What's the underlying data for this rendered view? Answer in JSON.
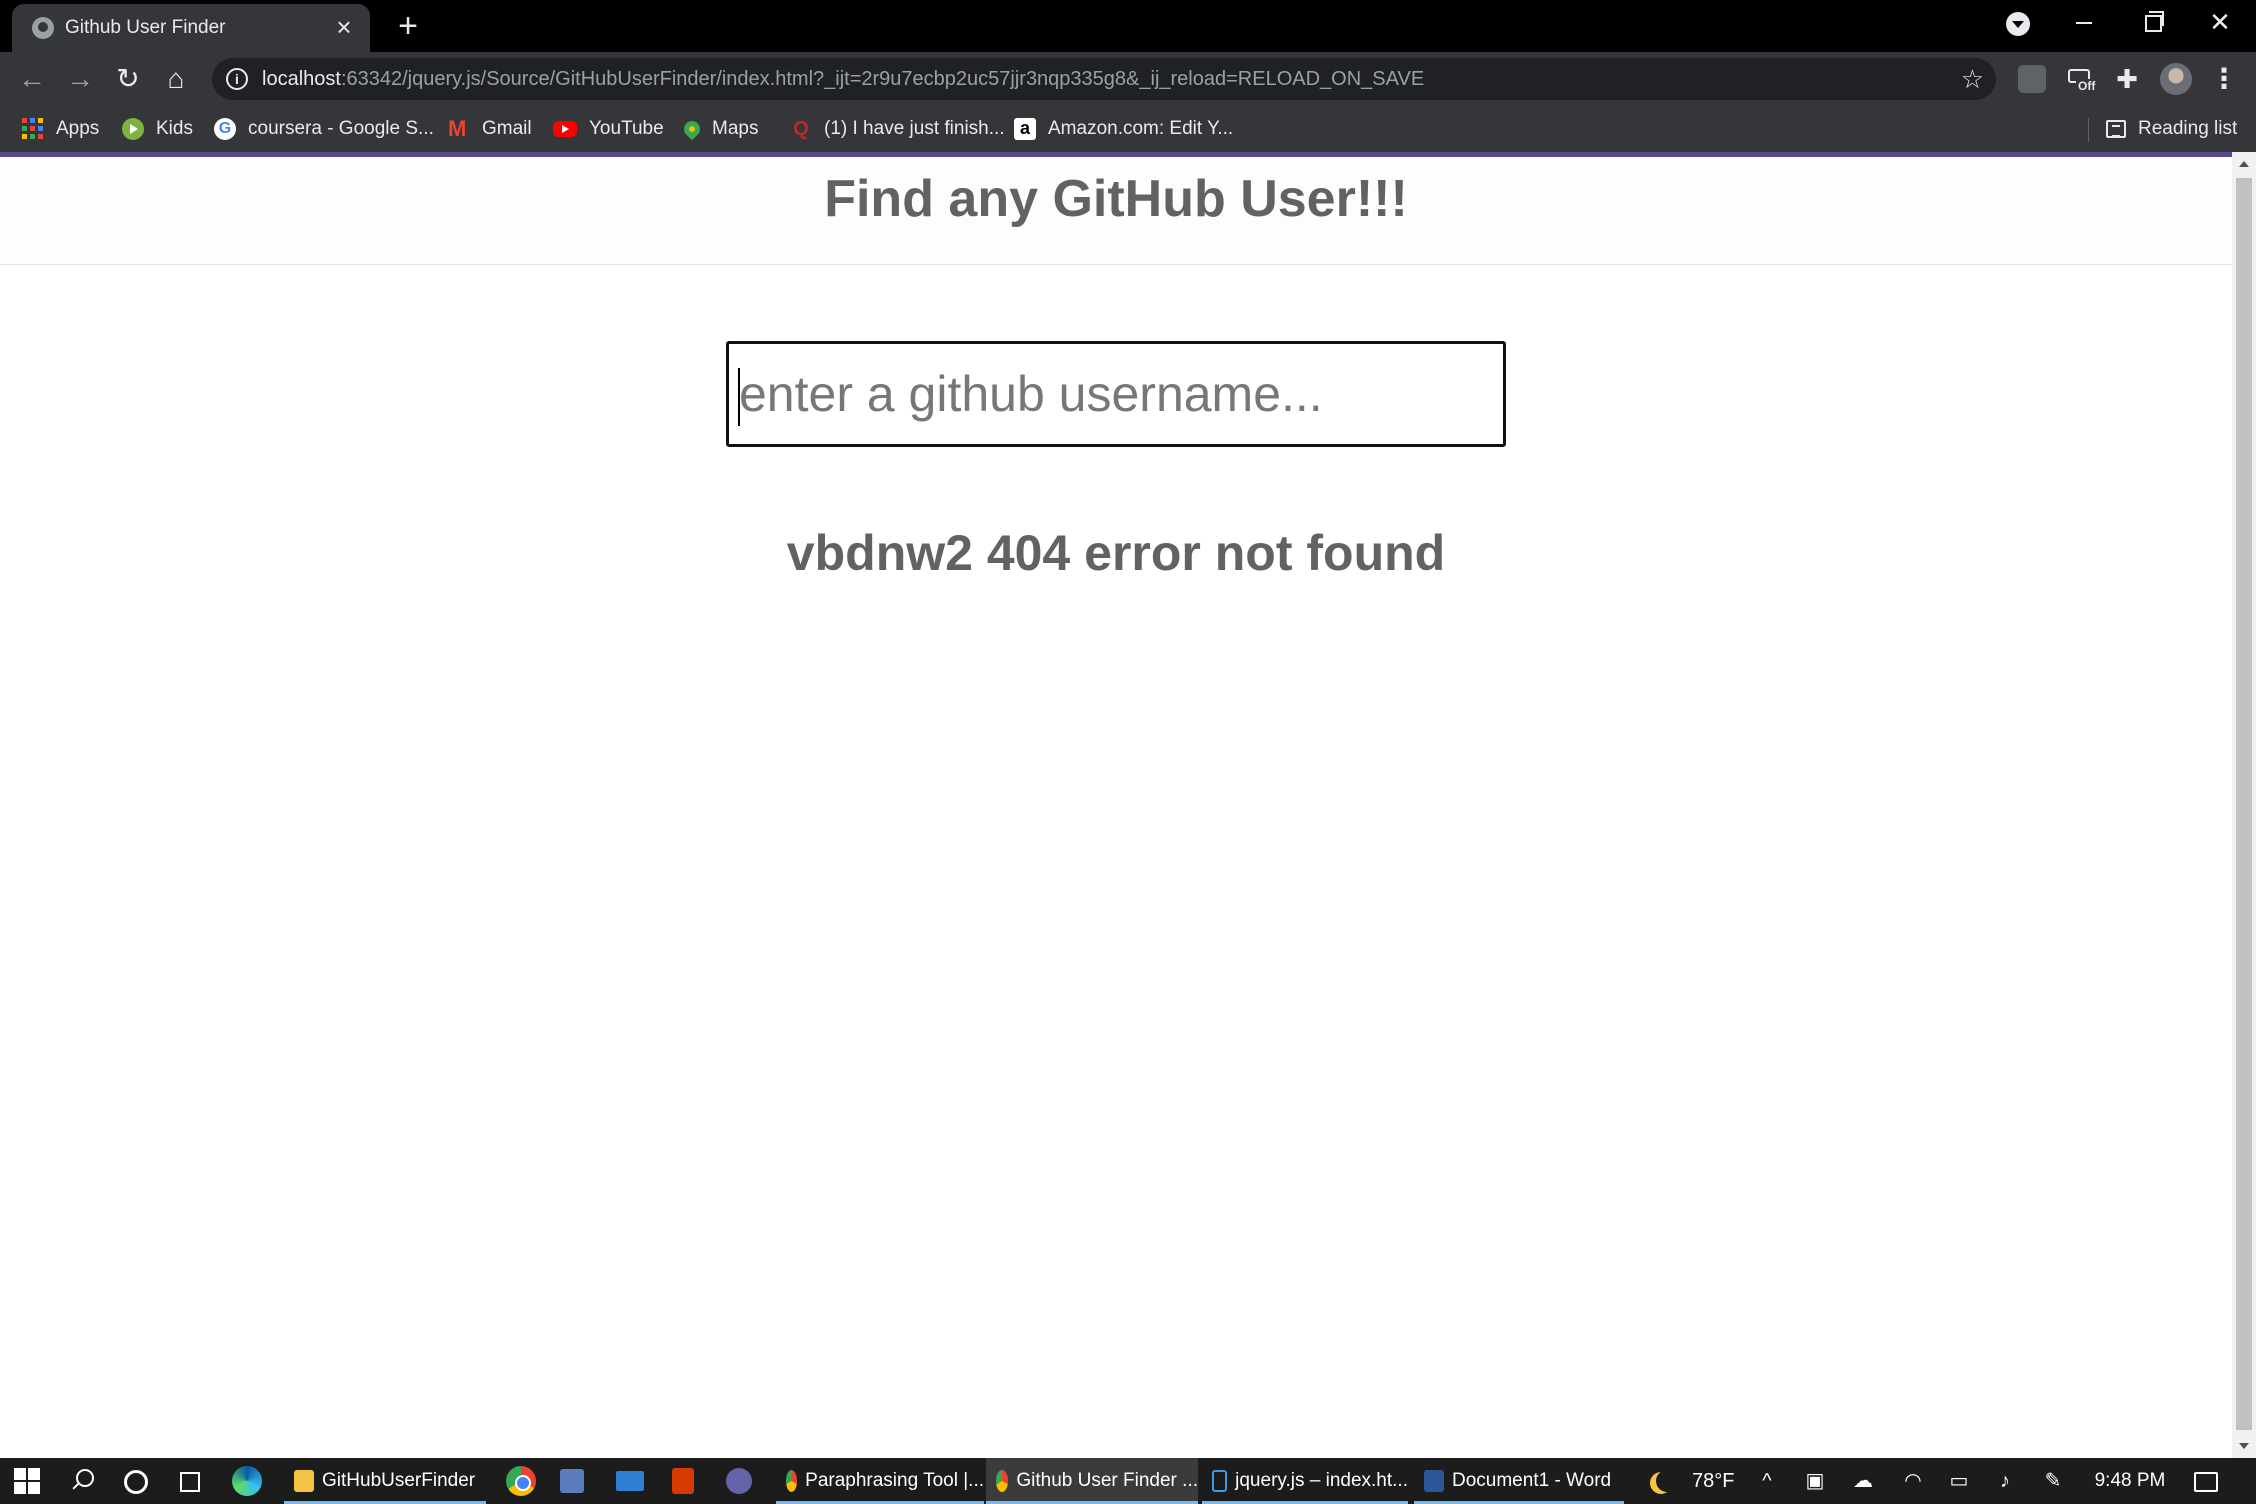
{
  "browser": {
    "tab_title": "Github User Finder",
    "url_host": "localhost",
    "url_rest": ":63342/jquery.js/Source/GitHubUserFinder/index.html?_ijt=2r9u7ecbp2uc57jjr3nqp335g8&_ij_reload=RELOAD_ON_SAVE",
    "bookmarks": {
      "apps": "Apps",
      "kids": "Kids",
      "coursera": "coursera - Google S...",
      "gmail": "Gmail",
      "youtube": "YouTube",
      "maps": "Maps",
      "quora": "(1) I have just finish...",
      "amazon": "Amazon.com: Edit Y...",
      "reading_list": "Reading list"
    },
    "extension_badge": "Off"
  },
  "page": {
    "title": "Find any GitHub User!!!",
    "search_placeholder": "enter a github username...",
    "search_value": "",
    "error_message": "vbdnw2 404 error not found"
  },
  "taskbar": {
    "apps": {
      "folder": "GitHubUserFinder",
      "paraphrasing": "Paraphrasing Tool |...",
      "github_finder": "Github User Finder ...",
      "jquery": "jquery.js – index.ht...",
      "word": "Document1 - Word"
    },
    "weather": "78°F",
    "time": "9:48 PM"
  },
  "colors": {
    "accent_line": "#5b4a8a",
    "heading_text": "#626262"
  }
}
